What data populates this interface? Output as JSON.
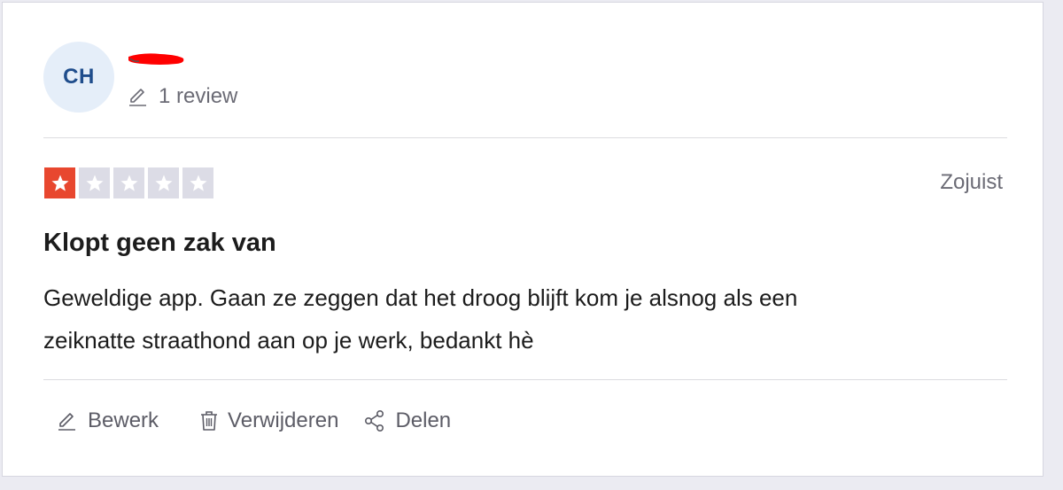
{
  "reviewer": {
    "initials": "CH",
    "review_count": "1 review"
  },
  "review": {
    "rating": 1,
    "max_rating": 5,
    "date": "Zojuist",
    "title": "Klopt geen zak van",
    "body_line1": "Geweldige app. Gaan ze zeggen dat het droog blijft kom je alsnog als een",
    "body_line2": "zeiknatte straathond aan op je werk, bedankt hè"
  },
  "actions": {
    "edit_label": "Bewerk",
    "delete_label": "Verwijderen",
    "share_label": "Delen"
  },
  "colors": {
    "star_active": "#e8472f",
    "star_inactive": "#dcdce6",
    "avatar_bg": "#e5eef9",
    "avatar_text": "#1f4d8c",
    "redaction": "#ff0000"
  },
  "icons": {
    "review_count": "pencil-icon",
    "edit": "pencil-icon",
    "delete": "trash-icon",
    "share": "share-icon"
  }
}
